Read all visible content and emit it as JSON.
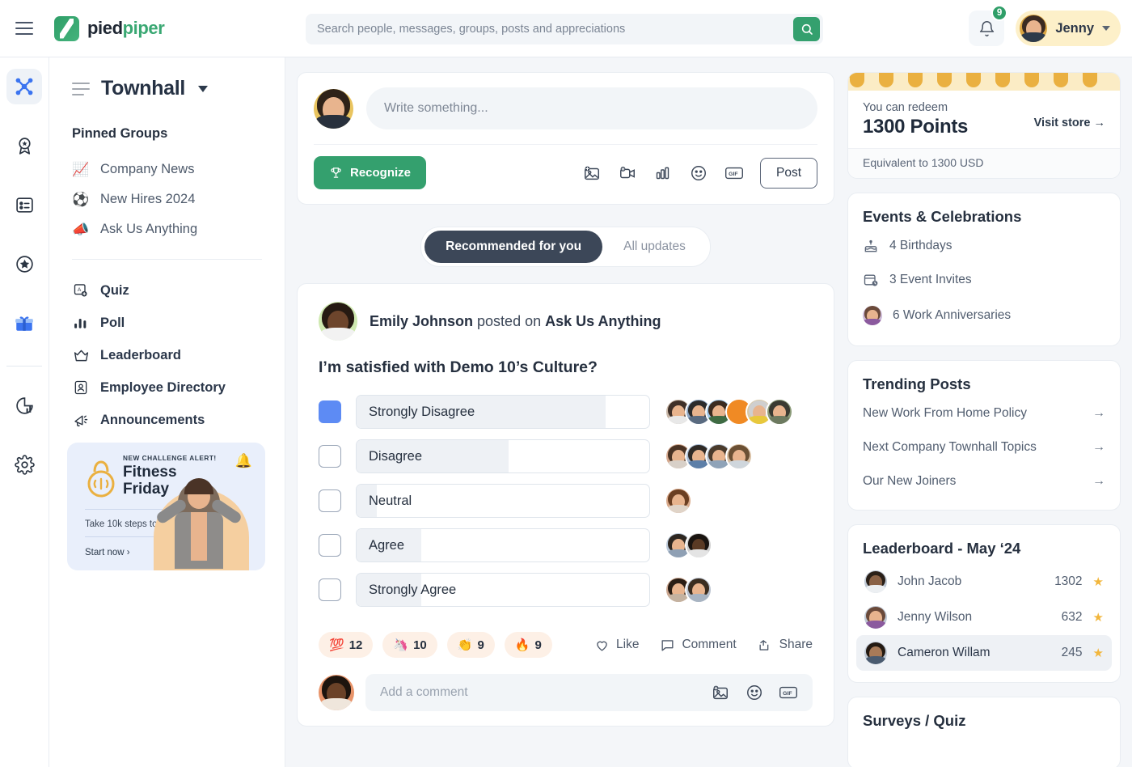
{
  "header": {
    "brand_primary": "pied",
    "brand_secondary": "piper",
    "search_placeholder": "Search people, messages, groups, posts and appreciations",
    "search_value": "",
    "notification_count": "9",
    "user_name": "Jenny"
  },
  "rail": {
    "items": [
      {
        "icon": "network-icon",
        "name": "dashboard"
      },
      {
        "icon": "award-ribbon-icon",
        "name": "awards"
      },
      {
        "icon": "list-card-icon",
        "name": "feed"
      },
      {
        "icon": "star-circle-icon",
        "name": "recognition"
      },
      {
        "icon": "gift-icon",
        "name": "rewards"
      },
      {
        "icon": "analytics-icon",
        "name": "analytics"
      },
      {
        "icon": "gear-icon",
        "name": "settings"
      }
    ]
  },
  "sidebar": {
    "title": "Townhall",
    "section_label": "Pinned Groups",
    "groups": [
      {
        "emoji": "📈",
        "label": "Company News"
      },
      {
        "emoji": "⚽",
        "label": "New Hires 2024"
      },
      {
        "emoji": "📣",
        "label": "Ask Us Anything"
      }
    ],
    "tools": [
      {
        "icon": "quiz-icon",
        "label": "Quiz"
      },
      {
        "icon": "poll-icon",
        "label": "Poll"
      },
      {
        "icon": "crown-icon",
        "label": "Leaderboard"
      },
      {
        "icon": "employee-directory-icon",
        "label": "Employee Directory"
      },
      {
        "icon": "megaphone-icon",
        "label": "Announcements"
      }
    ],
    "promo": {
      "alert": "NEW CHALLENGE ALERT!",
      "title_line1": "Fitness",
      "title_line2": "Friday",
      "subtitle": "Take 10k steps today.",
      "cta": "Start now ›",
      "bell_emoji": "🔔"
    }
  },
  "composer": {
    "placeholder": "Write something...",
    "value": "",
    "recognize_label": "Recognize",
    "post_label": "Post",
    "tools": [
      "add-photo-icon",
      "add-video-icon",
      "poll-bars-icon",
      "emoji-icon",
      "gif-icon"
    ]
  },
  "feed_tabs": [
    {
      "label": "Recommended for you",
      "active": true
    },
    {
      "label": "All updates",
      "active": false
    }
  ],
  "post": {
    "author": "Emily Johnson",
    "action": " posted on ",
    "group": "Ask Us Anything",
    "question": "I’m satisfied with Demo 10’s Culture?",
    "reactions": [
      {
        "emoji": "💯",
        "count": "12"
      },
      {
        "emoji": "🦄",
        "count": "10"
      },
      {
        "emoji": "👏",
        "count": "9"
      },
      {
        "emoji": "🔥",
        "count": "9"
      }
    ],
    "actions": [
      {
        "icon": "heart-icon",
        "label": "Like"
      },
      {
        "icon": "comment-icon",
        "label": "Comment"
      },
      {
        "icon": "share-icon",
        "label": "Share"
      }
    ],
    "comment_placeholder": "Add a comment",
    "comment_value": "",
    "comment_tools": [
      "add-photo-icon",
      "emoji-icon",
      "gif-icon"
    ]
  },
  "chart_data": {
    "type": "bar",
    "title": "I’m satisfied with Demo 10’s Culture?",
    "xlabel": "",
    "ylabel": "",
    "orientation": "horizontal",
    "categories": [
      "Strongly Disagree",
      "Disagree",
      "Neutral",
      "Agree",
      "Strongly Agree"
    ],
    "values": [
      85,
      52,
      7,
      22,
      22
    ],
    "unit": "percent",
    "xlim": [
      0,
      100
    ],
    "grid": false,
    "legend": false,
    "selected_index": 0,
    "voter_counts": [
      6,
      4,
      1,
      2,
      2
    ],
    "voter_colors": [
      [
        "#c8b6a6",
        "#8fa7c4",
        "#9fc6e6",
        "#f08a24",
        "#d8c9a8",
        "#8a9a78"
      ],
      [
        "#d6a98f",
        "#a9bcd4",
        "#b9c6d6",
        "#d9c0a4"
      ],
      [
        "#d8a98a"
      ],
      [
        "#bac8d8",
        "#6b5a4a"
      ],
      [
        "#caa68f",
        "#b9c2cf"
      ]
    ]
  },
  "right": {
    "points": {
      "label": "You can redeem",
      "value": "1300 Points",
      "link": "Visit store →",
      "equivalent": "Equivalent to 1300 USD"
    },
    "events": {
      "title": "Events & Celebrations",
      "items": [
        {
          "icon": "cake-icon",
          "label": "4 Birthdays"
        },
        {
          "icon": "calendar-clock-icon",
          "label": "3 Event Invites"
        },
        {
          "icon": "avatar-icon",
          "label": "6 Work Anniversaries"
        }
      ]
    },
    "trending": {
      "title": "Trending Posts",
      "items": [
        {
          "label": "New Work From Home Policy"
        },
        {
          "label": "Next Company Townhall Topics"
        },
        {
          "label": "Our New Joiners"
        }
      ]
    },
    "leaderboard": {
      "title": "Leaderboard - May ‘24",
      "rows": [
        {
          "name": "John Jacob",
          "points": "1302",
          "highlighted": false
        },
        {
          "name": "Jenny Wilson",
          "points": "632",
          "highlighted": false
        },
        {
          "name": "Cameron Willam",
          "points": "245",
          "highlighted": true
        }
      ]
    },
    "surveys": {
      "title": "Surveys / Quiz"
    }
  },
  "colors": {
    "brand_green": "#34a06e",
    "accent_blue": "#5d8bf4",
    "gold": "#eab040",
    "dark": "#3c4758"
  }
}
